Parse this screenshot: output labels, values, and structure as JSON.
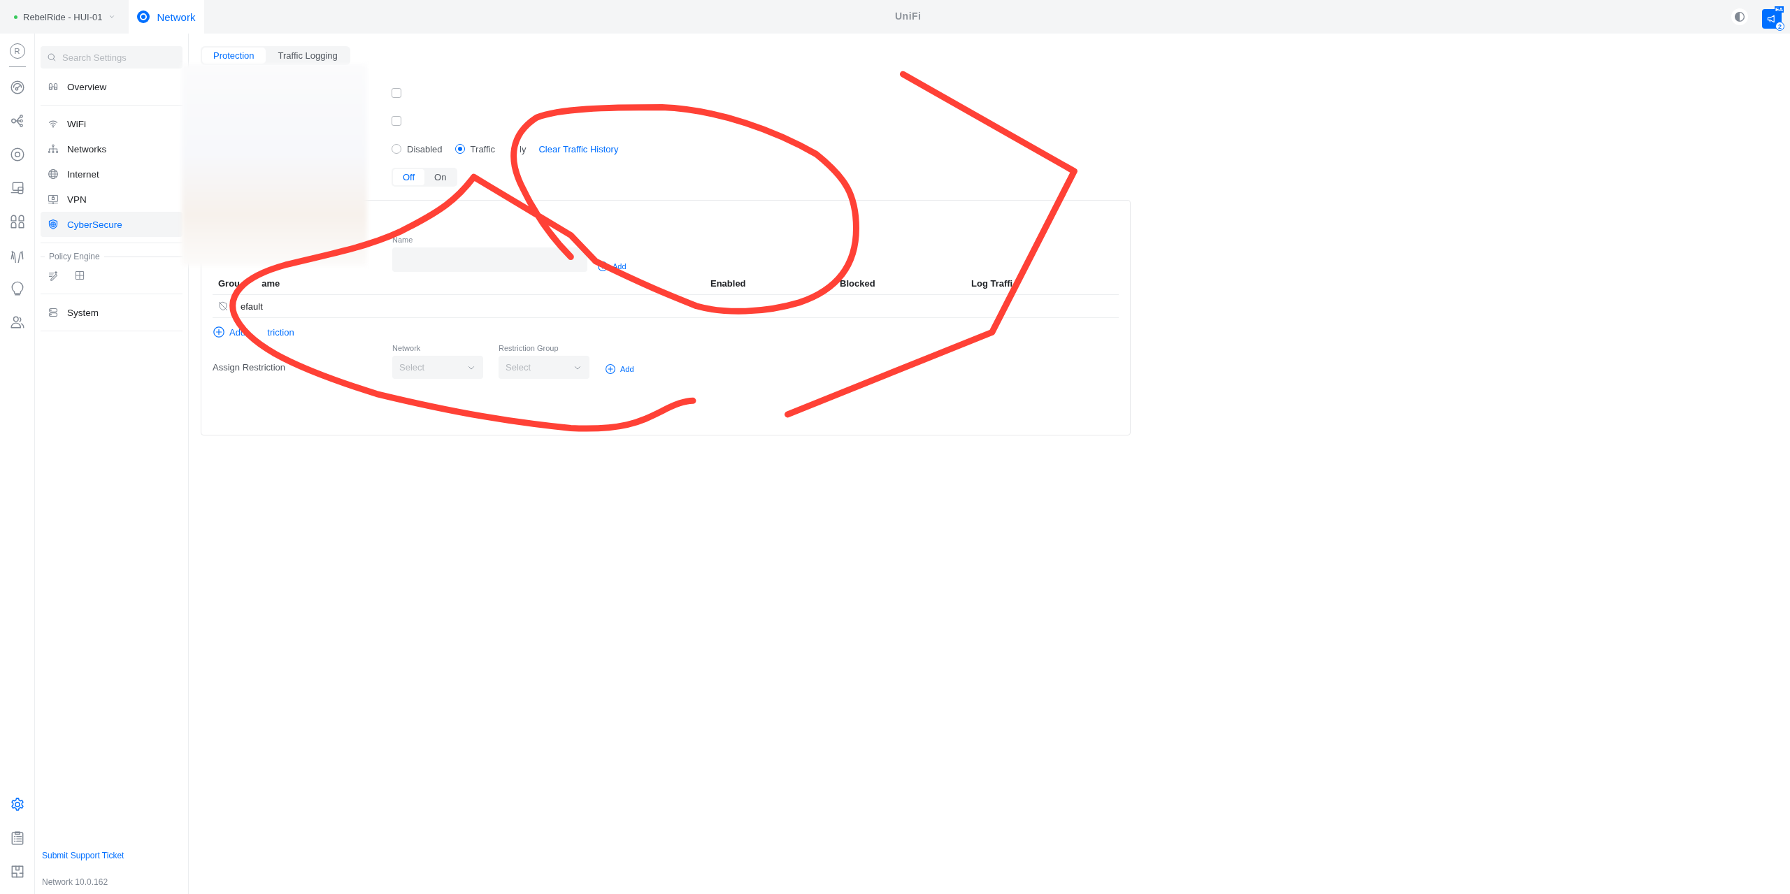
{
  "header": {
    "site": "RebelRide - HUI-01",
    "online": true,
    "app": "Network",
    "logo": "UniFi",
    "badge": "EA",
    "count": "2"
  },
  "rail": {
    "avatar": "R",
    "top": [
      {
        "selected": false
      },
      {
        "selected": false
      },
      {
        "selected": false
      },
      {
        "selected": false
      },
      {
        "selected": false
      },
      {
        "selected": false
      },
      {
        "selected": false
      },
      {
        "selected": false
      }
    ],
    "bottom": [
      {
        "selected": true
      },
      {
        "selected": false
      },
      {
        "selected": false
      }
    ]
  },
  "sidebar": {
    "search": {
      "placeholder": "Search Settings"
    },
    "sections": [
      {
        "items": [
          {
            "label": "Overview",
            "selected": false
          }
        ]
      },
      {
        "items": [
          {
            "label": "WiFi",
            "selected": false
          },
          {
            "label": "Networks",
            "selected": false
          },
          {
            "label": "Internet",
            "selected": false
          },
          {
            "label": "VPN",
            "selected": false
          },
          {
            "label": "CyberSecure",
            "selected": true
          }
        ]
      },
      {
        "title": "Policy Engine"
      },
      {
        "items": [
          {
            "label": "System",
            "selected": false
          }
        ]
      }
    ],
    "support_link": "Submit Support Ticket",
    "version": "Network 10.0.162"
  },
  "tabs": [
    {
      "label": "Protection",
      "selected": true
    },
    {
      "label": "Traffic Logging",
      "selected": false
    }
  ],
  "checkboxes": [
    {
      "checked": false
    },
    {
      "checked": false
    }
  ],
  "mode": {
    "options": [
      {
        "label": "Disabled",
        "selected": false
      },
      {
        "label": [
          "Traffic",
          "ly"
        ],
        "selected": true
      }
    ],
    "link": "Clear Traffic History"
  },
  "toggle": [
    {
      "label": "Off",
      "selected": true
    },
    {
      "label": "On",
      "selected": false
    }
  ],
  "restrictions": {
    "name_label": "Name",
    "add": "Add",
    "columns": [
      [
        "Grou",
        "ame"
      ],
      "Enabled",
      "Blocked",
      "Log Traffi"
    ],
    "rows": [
      {
        "name": "efault"
      }
    ],
    "add_restriction": [
      "Add",
      "triction"
    ],
    "assign": {
      "label": "Assign Restriction",
      "fields": [
        {
          "label": "Network",
          "placeholder": "Select"
        },
        {
          "label": "Restriction Group",
          "placeholder": "Select"
        }
      ],
      "add": "Add"
    }
  }
}
